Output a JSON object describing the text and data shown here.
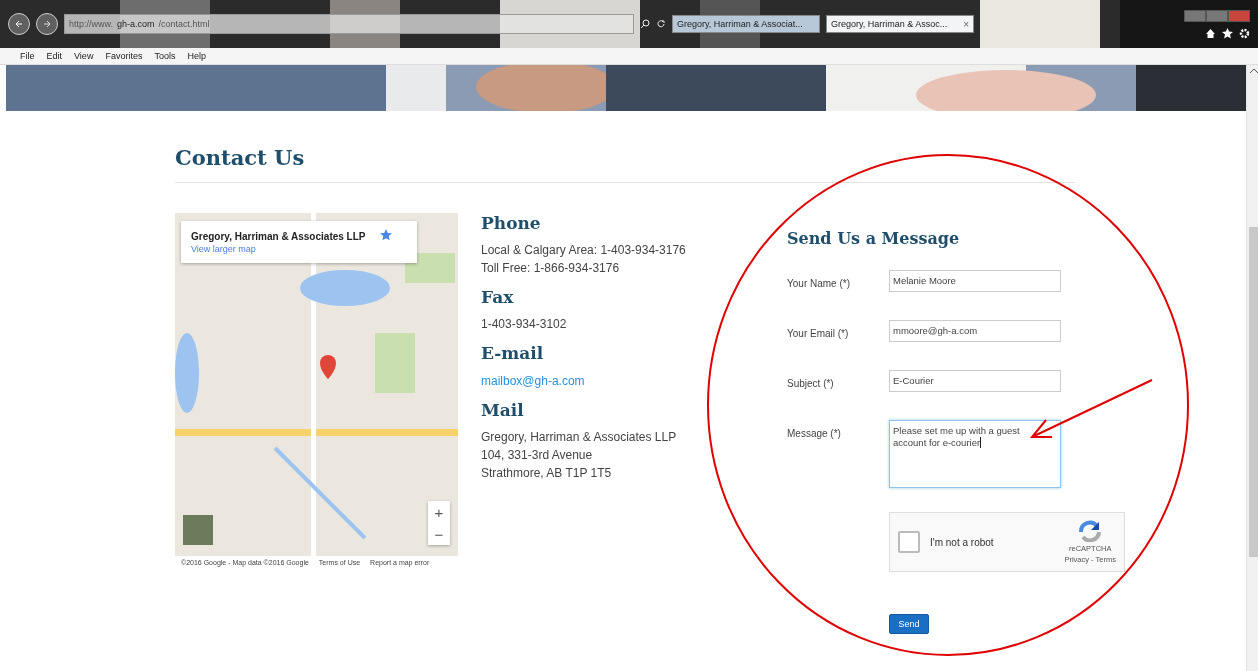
{
  "browser": {
    "url_prefix": "http://www.",
    "url_host": "gh-a.com",
    "url_path": "/contact.html",
    "tabs": [
      {
        "title": "Gregory, Harriman & Associat...",
        "selected": false
      },
      {
        "title": "Gregory, Harriman & Assoc...",
        "selected": true,
        "close": "×"
      }
    ],
    "menu": [
      "File",
      "Edit",
      "View",
      "Favorites",
      "Tools",
      "Help"
    ]
  },
  "page": {
    "heading": "Contact Us",
    "map": {
      "kind": "picture",
      "place_title": "Gregory, Harriman & Associates LLP",
      "link": "View larger map",
      "zoom_in": "+",
      "zoom_out": "−",
      "footer": [
        "©2016 Google - Map data ©2016 Google",
        "Terms of Use",
        "Report a map error"
      ]
    },
    "contact": [
      {
        "heading": "Phone",
        "lines": [
          {
            "kind": "text",
            "text": "Local & Calgary Area: 1-403-934-3176"
          },
          {
            "kind": "text",
            "text": "Toll Free: 1-866-934-3176"
          }
        ]
      },
      {
        "heading": "Fax",
        "lines": [
          {
            "kind": "text",
            "text": "1-403-934-3102"
          }
        ]
      },
      {
        "heading": "E-mail",
        "lines": [
          {
            "kind": "link",
            "text": "mailbox@gh-a.com"
          }
        ]
      },
      {
        "heading": "Mail",
        "lines": [
          {
            "kind": "text",
            "text": "Gregory, Harriman & Associates LLP"
          },
          {
            "kind": "text",
            "text": "104, 331-3rd Avenue"
          },
          {
            "kind": "text",
            "text": "Strathmore, AB T1P 1T5"
          }
        ]
      }
    ],
    "form": {
      "title": "Send Us a Message",
      "fields": [
        {
          "kind": "input",
          "label": "Your Name (*)",
          "value": "Melanie Moore",
          "focused": false
        },
        {
          "kind": "input",
          "label": "Your Email (*)",
          "value": "mmoore@gh-a.com",
          "focused": false
        },
        {
          "kind": "input",
          "label": "Subject (*)",
          "value": "E-Courier",
          "focused": false
        },
        {
          "kind": "textarea",
          "label": "Message (*)",
          "value": "Please set me up with a guest account for e-courier",
          "focused": true
        }
      ],
      "captcha": {
        "label": "I'm not a robot",
        "checked": false,
        "brand": "reCAPTCHA",
        "links": "Privacy - Terms"
      },
      "button": "Send"
    }
  }
}
